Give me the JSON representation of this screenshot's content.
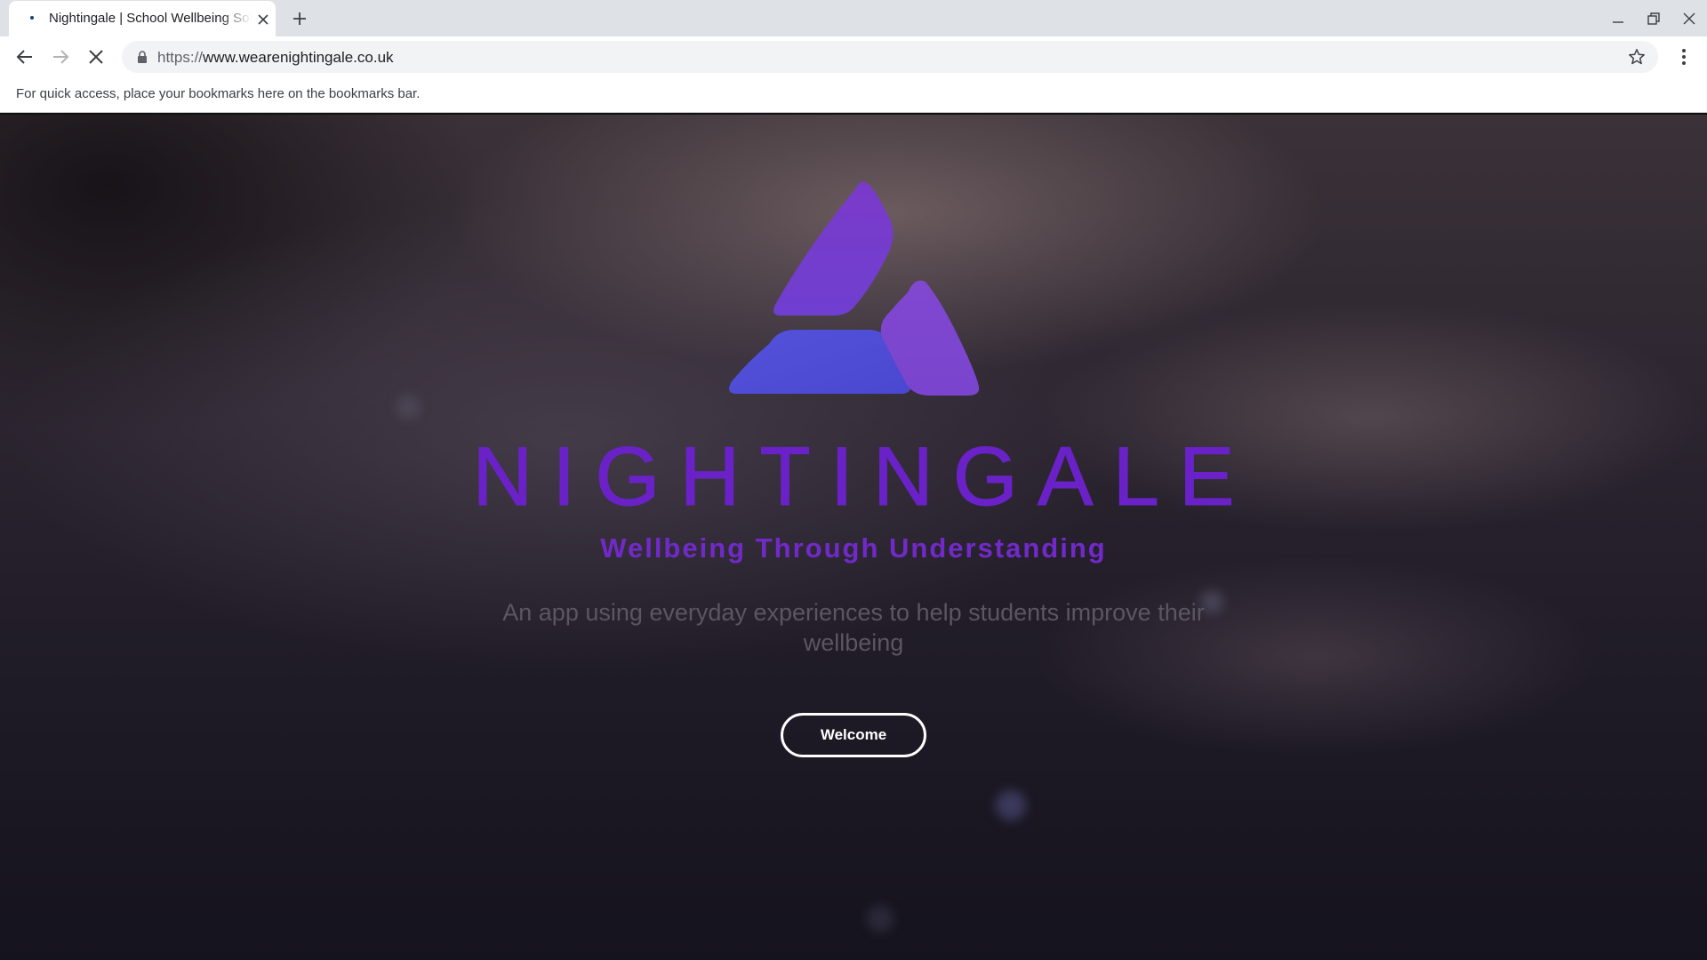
{
  "browser": {
    "tab": {
      "title": "Nightingale | School Wellbeing Software"
    },
    "address_bar": {
      "scheme": "https://",
      "host": "www.wearenightingale.co.uk"
    },
    "bookmarks_bar": {
      "hint": "For quick access, place your bookmarks here on the bookmarks bar."
    },
    "icons": {
      "back": "arrow-left-icon",
      "forward": "arrow-right-icon",
      "stop": "close-icon",
      "lock": "lock-icon",
      "star": "star-icon",
      "menu": "kebab-menu-icon",
      "new_tab": "plus-icon",
      "minimize": "minimize-icon",
      "restore": "restore-icon",
      "close": "close-icon"
    }
  },
  "page": {
    "brand": "NIGHTINGALE",
    "tagline": "Wellbeing Through Understanding",
    "description": "An app using everyday experiences to help students improve their wellbeing",
    "welcome_button": "Welcome",
    "colors": {
      "brand_purple": "#6a22c8",
      "logo_top": "#7b3ec9",
      "logo_left": "#4f4bd6",
      "logo_right": "#7e45cf"
    }
  }
}
